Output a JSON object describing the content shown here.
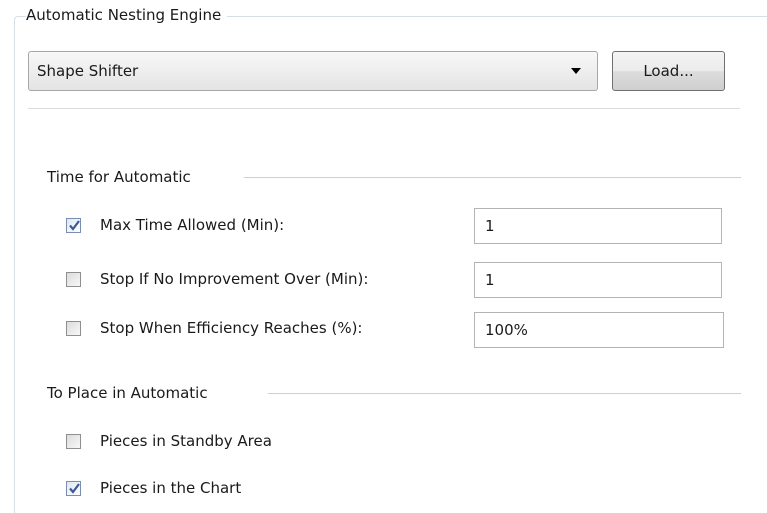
{
  "group": {
    "title": "Automatic Nesting Engine"
  },
  "engine": {
    "selected": "Shape Shifter",
    "load_label": "Load..."
  },
  "time_section": {
    "title": "Time for Automatic",
    "rows": [
      {
        "label": "Max Time Allowed (Min):",
        "checked": true,
        "value": "1"
      },
      {
        "label": "Stop If No Improvement Over (Min):",
        "checked": false,
        "value": "1"
      },
      {
        "label": "Stop When Efficiency Reaches (%):",
        "checked": false,
        "value": "100%"
      }
    ]
  },
  "place_section": {
    "title": "To Place in Automatic",
    "options": [
      {
        "label": "Pieces in Standby Area",
        "checked": false
      },
      {
        "label": "Pieces in the Chart",
        "checked": true
      }
    ]
  },
  "colors": {
    "check_mark": "#3b5a9a",
    "frame_border": "#d5dfe5"
  }
}
